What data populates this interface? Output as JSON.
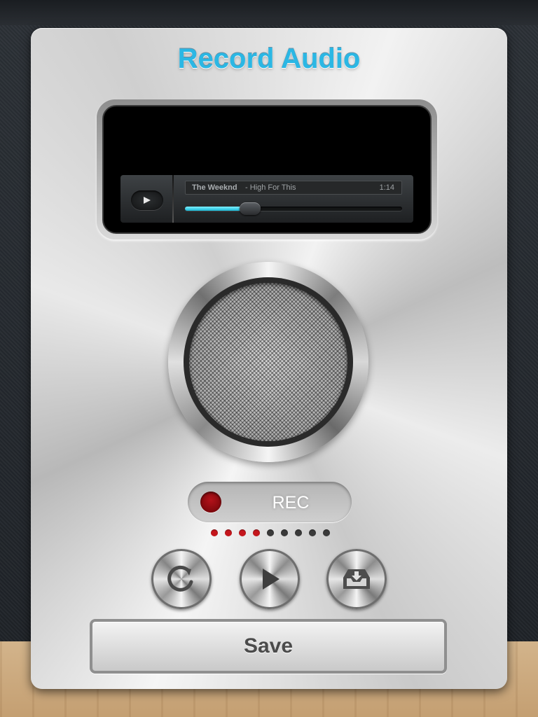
{
  "title": "Record Audio",
  "player": {
    "play_icon": "play-icon",
    "artist": "The Weeknd",
    "track": "- High For This",
    "time": "1:14",
    "progress": 0.3
  },
  "speaker": {
    "icon": "speaker-grille"
  },
  "rec": {
    "label": "REC",
    "dot_color": "#b4121a"
  },
  "level_meter": {
    "count": 9,
    "lit": 4,
    "lit_color": "#c4161c",
    "unlit_color": "#3a3a3a"
  },
  "controls": [
    {
      "name": "reset-button",
      "icon": "refresh-icon"
    },
    {
      "name": "play-button",
      "icon": "play-icon"
    },
    {
      "name": "save-to-tray-button",
      "icon": "inbox-download-icon"
    }
  ],
  "save_label": "Save",
  "colors": {
    "accent": "#2bb7e4",
    "progress": "#18b8d6"
  }
}
